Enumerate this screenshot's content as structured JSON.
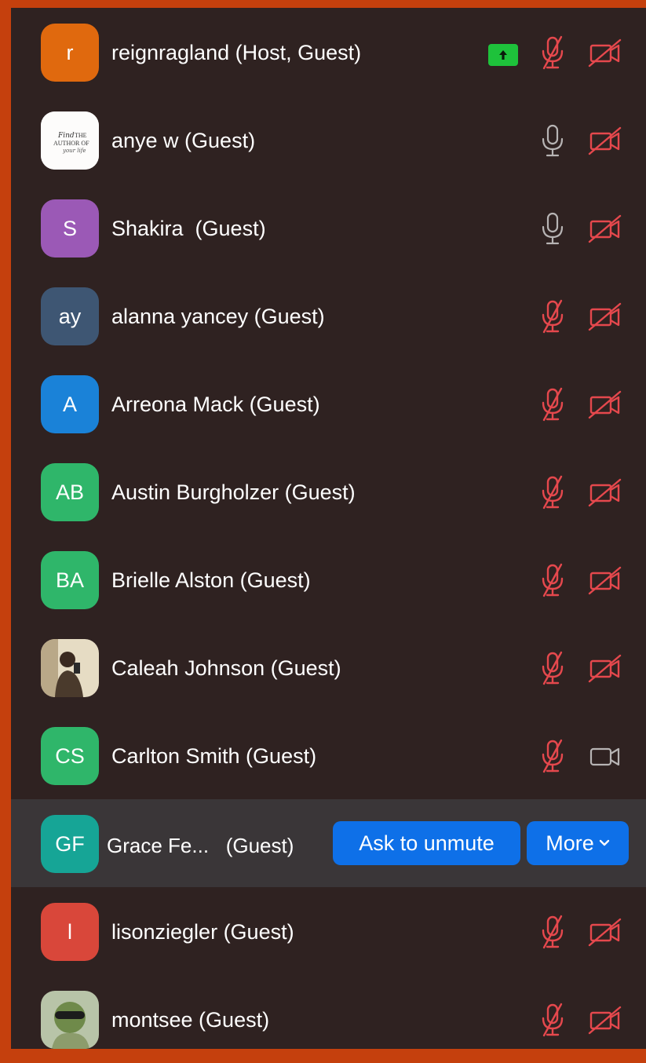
{
  "participants": [
    {
      "name": "reignragland (Host, Guest)",
      "initials": "r",
      "avatar_color": "#e0690e",
      "avatar_type": "initials",
      "mic": "muted",
      "video": "off",
      "sharing": true
    },
    {
      "name": "anye w (Guest)",
      "initials": "",
      "avatar_color": "#ffffff",
      "avatar_type": "logo",
      "avatar_logo_text": "Find THE AUTHOR OF your life",
      "mic": "unmuted",
      "video": "off",
      "sharing": false
    },
    {
      "name": "Shakira  (Guest)",
      "initials": "S",
      "avatar_color": "#9b59b6",
      "avatar_type": "initials",
      "mic": "unmuted",
      "video": "off",
      "sharing": false
    },
    {
      "name": "alanna yancey (Guest)",
      "initials": "ay",
      "avatar_color": "#3e5673",
      "avatar_type": "initials",
      "mic": "muted",
      "video": "off",
      "sharing": false
    },
    {
      "name": "Arreona Mack (Guest)",
      "initials": "A",
      "avatar_color": "#1a82d8",
      "avatar_type": "initials",
      "mic": "muted",
      "video": "off",
      "sharing": false
    },
    {
      "name": "Austin Burgholzer (Guest)",
      "initials": "AB",
      "avatar_color": "#2fb66a",
      "avatar_type": "initials",
      "mic": "muted",
      "video": "off",
      "sharing": false
    },
    {
      "name": "Brielle Alston (Guest)",
      "initials": "BA",
      "avatar_color": "#2fb66a",
      "avatar_type": "initials",
      "mic": "muted",
      "video": "off",
      "sharing": false
    },
    {
      "name": "Caleah Johnson (Guest)",
      "initials": "",
      "avatar_color": "#d8c8a8",
      "avatar_type": "photo",
      "mic": "muted",
      "video": "off",
      "sharing": false
    },
    {
      "name": "Carlton Smith (Guest)",
      "initials": "CS",
      "avatar_color": "#2fb66a",
      "avatar_type": "initials",
      "mic": "muted",
      "video": "on",
      "sharing": false
    },
    {
      "name": "Grace Fe...   (Guest)",
      "initials": "GF",
      "avatar_color": "#16a596",
      "avatar_type": "initials",
      "mic": "muted",
      "video": "off",
      "sharing": false,
      "hovered": true
    },
    {
      "name": "lisonziegler (Guest)",
      "initials": "l",
      "avatar_color": "#d9473a",
      "avatar_type": "initials",
      "mic": "muted",
      "video": "off",
      "sharing": false
    },
    {
      "name": "montsee (Guest)",
      "initials": "",
      "avatar_color": "#8aa080",
      "avatar_type": "photo",
      "mic": "muted",
      "video": "off",
      "sharing": false
    }
  ],
  "actions": {
    "ask_to_unmute": "Ask to unmute",
    "more": "More"
  },
  "colors": {
    "panel_bg": "#2f2221",
    "frame": "#c5400d",
    "hover_row": "#3a3638",
    "muted_red": "#e5484d",
    "neutral_icon": "#b7b4b4",
    "share_green": "#1ec23b",
    "button_blue": "#0e70e8"
  }
}
